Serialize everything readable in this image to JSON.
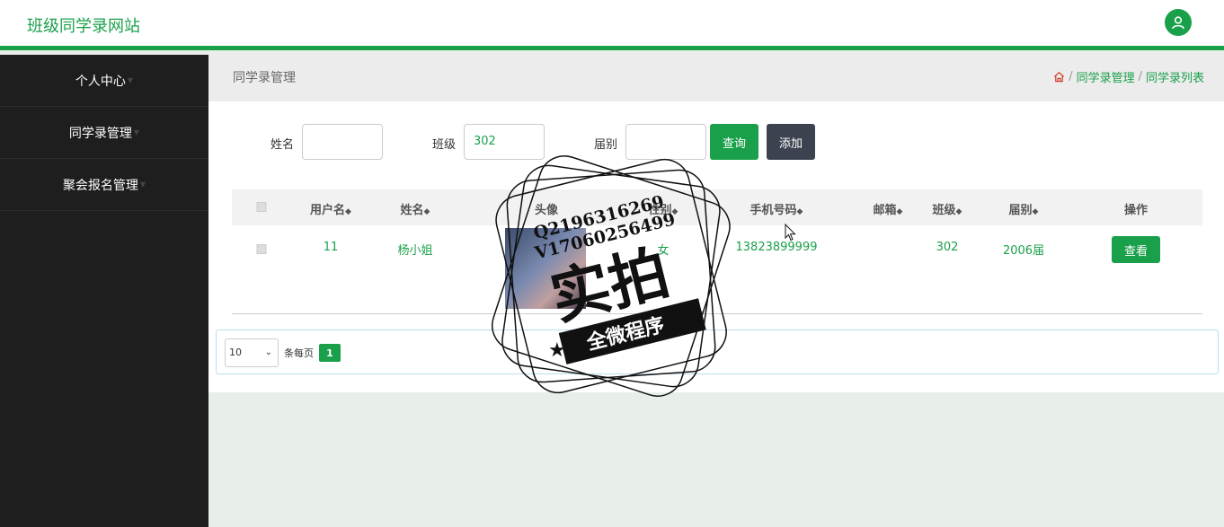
{
  "app": {
    "title": "班级同学录网站"
  },
  "colors": {
    "accent": "#1aa04a",
    "sidebar_bg": "#1e1e1e",
    "add_button": "#3d4250"
  },
  "icons": {
    "user": "user-icon",
    "home": "home-icon",
    "sort": "sort-icon"
  },
  "sidebar": {
    "items": [
      {
        "label": "个人中心"
      },
      {
        "label": "同学录管理"
      },
      {
        "label": "聚会报名管理"
      }
    ]
  },
  "header": {
    "page_title": "同学录管理",
    "breadcrumb": [
      "同学录管理",
      "同学录列表"
    ],
    "separator": "/"
  },
  "search": {
    "name_label": "姓名",
    "name_value": "",
    "class_label": "班级",
    "class_value": "302",
    "session_label": "届别",
    "session_value": "",
    "query_button": "查询",
    "add_button": "添加"
  },
  "table": {
    "columns": [
      "用户名",
      "姓名",
      "头像",
      "性别",
      "手机号码",
      "邮箱",
      "班级",
      "届别",
      "操作"
    ],
    "sort_glyph": "◆",
    "rows": [
      {
        "username": "11",
        "name": "杨小姐",
        "gender": "女",
        "phone": "13823899999",
        "email": "",
        "class": "302",
        "session": "2006届",
        "action": "查看"
      }
    ]
  },
  "pagination": {
    "page_size": "10",
    "per_page_label": "条每页",
    "current_page": "1"
  },
  "watermark": {
    "line1": "Q2196316269",
    "line2": "V17060256499",
    "big": "实拍",
    "banner": "全微程序"
  }
}
